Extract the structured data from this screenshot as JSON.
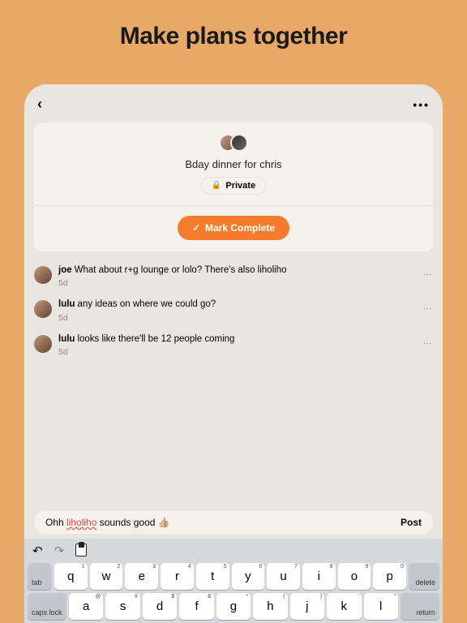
{
  "hero": {
    "title": "Make plans together"
  },
  "topbar": {
    "back_glyph": "‹",
    "more_glyph": "•••"
  },
  "card": {
    "title": "Bday dinner for chris",
    "privacy_label": "Private",
    "lock_glyph": "🔒",
    "complete_label": "Mark Complete",
    "check_glyph": "✓"
  },
  "comments": [
    {
      "user": "joe",
      "text": "What about r+g lounge or lolo? There's also liholiho",
      "time": "5d"
    },
    {
      "user": "lulu",
      "text": "any ideas on where we could go?",
      "time": "5d"
    },
    {
      "user": "lulu",
      "text": "looks like there'll be 12 people coming",
      "time": "5d"
    }
  ],
  "compose": {
    "pre": "Ohh ",
    "highlight": "liholiho",
    "post": " sounds good 👍🏼",
    "post_label": "Post"
  },
  "toolbar": {
    "undo": "↶",
    "redo": "↷"
  },
  "keyboard": {
    "tab": "tab",
    "delete": "delete",
    "capslock": "caps lock",
    "return": "return",
    "row1": [
      {
        "m": "q",
        "s": "1"
      },
      {
        "m": "w",
        "s": "2"
      },
      {
        "m": "e",
        "s": "3"
      },
      {
        "m": "r",
        "s": "4"
      },
      {
        "m": "t",
        "s": "5"
      },
      {
        "m": "y",
        "s": "6"
      },
      {
        "m": "u",
        "s": "7"
      },
      {
        "m": "i",
        "s": "8"
      },
      {
        "m": "o",
        "s": "9"
      },
      {
        "m": "p",
        "s": "0"
      }
    ],
    "row2": [
      {
        "m": "a",
        "s": "@"
      },
      {
        "m": "s",
        "s": "#"
      },
      {
        "m": "d",
        "s": "$"
      },
      {
        "m": "f",
        "s": "&"
      },
      {
        "m": "g",
        "s": "*"
      },
      {
        "m": "h",
        "s": "("
      },
      {
        "m": "j",
        "s": ")"
      },
      {
        "m": "k",
        "s": "'"
      },
      {
        "m": "l",
        "s": "\""
      }
    ]
  }
}
